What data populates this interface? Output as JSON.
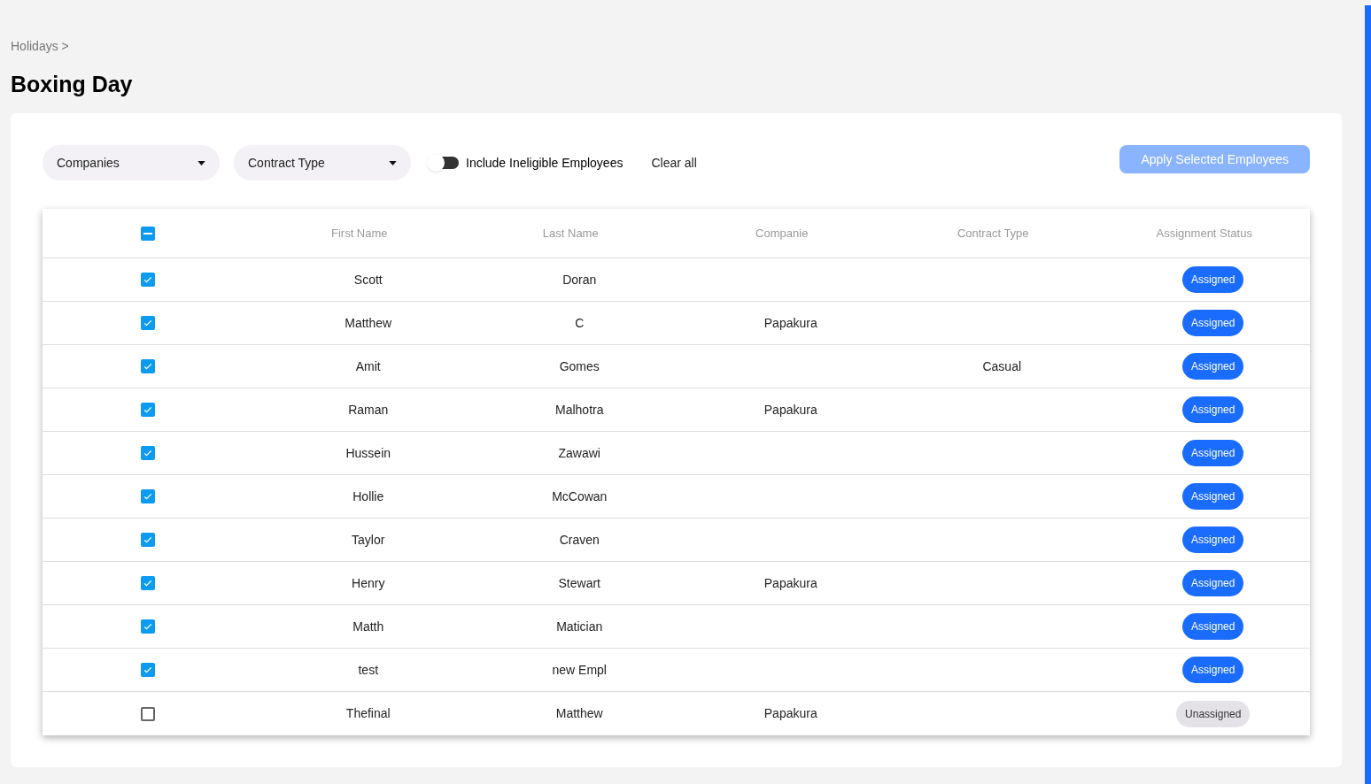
{
  "breadcrumb": "Holidays >",
  "title": "Boxing Day",
  "filters": [
    {
      "label": "Companies"
    },
    {
      "label": "Contract Type"
    }
  ],
  "toggle": {
    "label": "Include Ineligible Employees",
    "on": false
  },
  "clear_all": "Clear all",
  "apply_button": {
    "label": "Apply Selected Employees",
    "disabled": true
  },
  "table": {
    "select_all": {
      "indeterminate": true
    },
    "columns": [
      "First Name",
      "Last Name",
      "Companie",
      "Contract Type",
      "Assignment Status"
    ],
    "rows": [
      {
        "checked": true,
        "cells": [
          "Scott",
          "Doran",
          "",
          ""
        ],
        "status": {
          "kind": "assigned",
          "label": "Assigned"
        }
      },
      {
        "checked": true,
        "cells": [
          "Matthew",
          "C",
          "Papakura",
          ""
        ],
        "status": {
          "kind": "assigned",
          "label": "Assigned"
        }
      },
      {
        "checked": true,
        "cells": [
          "Amit",
          "Gomes",
          "",
          "Casual"
        ],
        "status": {
          "kind": "assigned",
          "label": "Assigned"
        }
      },
      {
        "checked": true,
        "cells": [
          "Raman",
          "Malhotra",
          "Papakura",
          ""
        ],
        "status": {
          "kind": "assigned",
          "label": "Assigned"
        }
      },
      {
        "checked": true,
        "cells": [
          "Hussein",
          "Zawawi",
          "",
          ""
        ],
        "status": {
          "kind": "assigned",
          "label": "Assigned"
        }
      },
      {
        "checked": true,
        "cells": [
          "Hollie",
          "McCowan",
          "",
          ""
        ],
        "status": {
          "kind": "assigned",
          "label": "Assigned"
        }
      },
      {
        "checked": true,
        "cells": [
          "Taylor",
          "Craven",
          "",
          ""
        ],
        "status": {
          "kind": "assigned",
          "label": "Assigned"
        }
      },
      {
        "checked": true,
        "cells": [
          "Henry",
          "Stewart",
          "Papakura",
          ""
        ],
        "status": {
          "kind": "assigned",
          "label": "Assigned"
        }
      },
      {
        "checked": true,
        "cells": [
          "Matth",
          "Matician",
          "",
          ""
        ],
        "status": {
          "kind": "assigned",
          "label": "Assigned"
        }
      },
      {
        "checked": true,
        "cells": [
          "test",
          "new Empl",
          "",
          ""
        ],
        "status": {
          "kind": "assigned",
          "label": "Assigned"
        }
      },
      {
        "checked": false,
        "cells": [
          "Thefinal",
          "Matthew",
          "Papakura",
          ""
        ],
        "status": {
          "kind": "unassigned",
          "label": "Unassigned"
        }
      }
    ]
  }
}
